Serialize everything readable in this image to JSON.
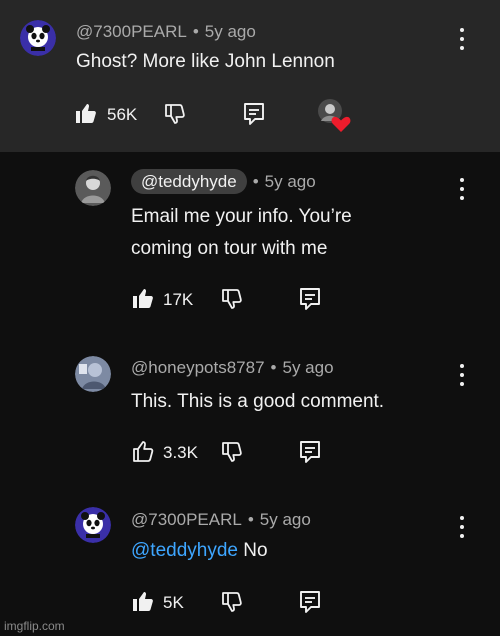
{
  "watermark": "imgflip.com",
  "comments": [
    {
      "handle": "@7300PEARL",
      "age": "5y ago",
      "text": "Ghost? More like John Lennon",
      "likes": "56K",
      "liked": true,
      "creator_heart": true
    },
    {
      "handle": "@teddyhyde",
      "age": "5y ago",
      "text_line1": "Email me your info. You’re",
      "text_line2": "coming on tour with me",
      "likes": "17K",
      "liked": true
    },
    {
      "handle": "@honeypots8787",
      "age": "5y ago",
      "text": "This. This is a good comment.",
      "likes": "3.3K",
      "liked": false
    },
    {
      "handle": "@7300PEARL",
      "age": "5y ago",
      "mention": "@teddyhyde",
      "text": "No",
      "likes": "5K",
      "liked": true
    }
  ]
}
